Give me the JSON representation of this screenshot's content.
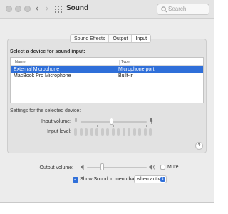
{
  "window": {
    "title": "Sound",
    "search_placeholder": "Search",
    "back_glyph": "‹",
    "forward_glyph": "›"
  },
  "tabs": [
    {
      "label": "Sound Effects",
      "active": false
    },
    {
      "label": "Output",
      "active": false
    },
    {
      "label": "Input",
      "active": true
    }
  ],
  "input": {
    "device_heading": "Select a device for sound input:",
    "columns": [
      "Name",
      "Type"
    ],
    "devices": [
      {
        "name": "External Microphone",
        "type": "Microphone port",
        "selected": true
      },
      {
        "name": "MacBook Pro Microphone",
        "type": "Built-in",
        "selected": false
      }
    ],
    "settings_heading": "Settings for the selected device:",
    "input_volume_label": "Input volume:",
    "input_volume_value": 0.46,
    "input_level_label": "Input level:",
    "input_level_segments_lit": 0,
    "help_label": "?"
  },
  "output": {
    "volume_label": "Output volume:",
    "volume_value": 0.25,
    "mute_label": "Mute",
    "muted": false
  },
  "menubar": {
    "show_label": "Show Sound in menu bar",
    "checked": true,
    "when_value": "when active"
  },
  "icons": {
    "grid": "grid-icon",
    "search": "search-icon",
    "mic": "microphone-icon",
    "speaker": "speaker-icon"
  },
  "colors": {
    "accent": "#2f6fd9",
    "background": "#ececec"
  }
}
